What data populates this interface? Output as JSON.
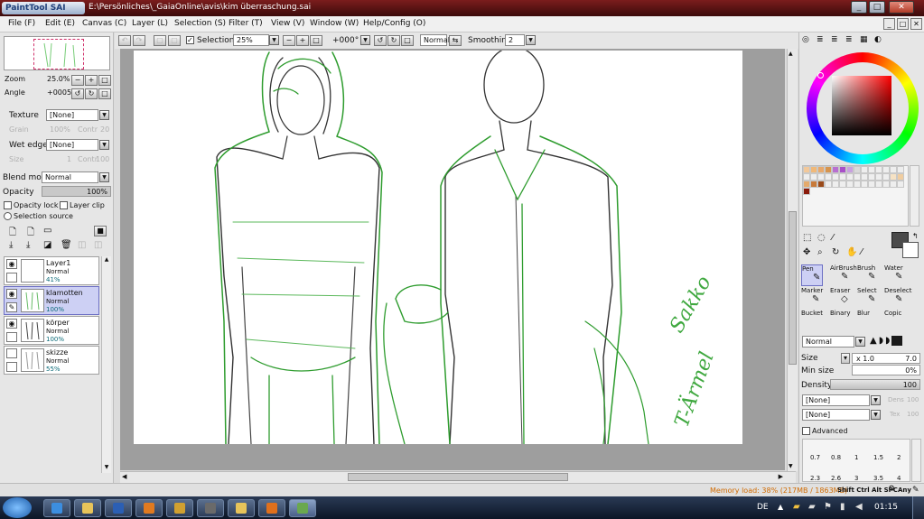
{
  "titlebar": {
    "app": "PaintTool SAI",
    "path": "E:\\Persönliches\\_GaiaOnline\\avis\\kim überraschung.sai",
    "min": "_",
    "max": "□",
    "close": "✕"
  },
  "menu": [
    "File (F)",
    "Edit (E)",
    "Canvas (C)",
    "Layer (L)",
    "Selection (S)",
    "Filter (T)",
    "View (V)",
    "Window (W)",
    "Help/Config (O)"
  ],
  "navigator": {
    "zoom_label": "Zoom",
    "zoom_value": "25.0%",
    "angle_label": "Angle",
    "angle_value": "+0005"
  },
  "texture": {
    "label": "Texture",
    "value": "[None]",
    "grain_label": "Grain",
    "grain_value": "100%",
    "conn_label": "Contr",
    "conn_value": "20"
  },
  "wetedge": {
    "label": "Wet edge",
    "value": "[None]",
    "size_label": "Size",
    "size_value": "1",
    "conn_label": "Contr",
    "conn_value": "100"
  },
  "blend": {
    "label": "Blend mode",
    "value": "Normal"
  },
  "opacity": {
    "label": "Opacity",
    "value": "100%"
  },
  "checks": {
    "opacity_lock": "Opacity lock",
    "layer_clip": "Layer clip",
    "selection_source": "Selection source"
  },
  "layers": [
    {
      "name": "Layer1",
      "mode": "Normal",
      "opacity": "41%",
      "selected": false
    },
    {
      "name": "klamotten",
      "mode": "Normal",
      "opacity": "100%",
      "selected": true
    },
    {
      "name": "körper",
      "mode": "Normal",
      "opacity": "100%",
      "selected": false
    },
    {
      "name": "skizze",
      "mode": "Normal",
      "opacity": "55%",
      "selected": false
    }
  ],
  "canvas_toolbar": {
    "selection_label": "Selection",
    "zoom": "25%",
    "angle": "+000°",
    "mode": "Normal",
    "smoothing_label": "Smoothing",
    "smoothing_value": "2"
  },
  "canvas_text": {
    "word1": "Sakko",
    "word2": "T-Ärmel"
  },
  "tools": [
    {
      "name": "Pen",
      "selected": true
    },
    {
      "name": "AirBrush",
      "selected": false
    },
    {
      "name": "Brush",
      "selected": false
    },
    {
      "name": "Water",
      "selected": false
    },
    {
      "name": "Marker",
      "selected": false
    },
    {
      "name": "Eraser",
      "selected": false
    },
    {
      "name": "Select",
      "selected": false
    },
    {
      "name": "Deselect",
      "selected": false
    },
    {
      "name": "Bucket",
      "selected": false
    },
    {
      "name": "Binary",
      "selected": false
    },
    {
      "name": "Blur",
      "selected": false
    },
    {
      "name": "Copic",
      "selected": false
    }
  ],
  "brush": {
    "mode": "Normal",
    "size_label": "Size",
    "size_mult": "x 1.0",
    "size_value": "7.0",
    "minsize_label": "Min size",
    "minsize_value": "0%",
    "density_label": "Density",
    "density_value": "100",
    "tex1": "[None]",
    "tex1_r": "Dens",
    "tex1_v": "100",
    "tex2": "[None]",
    "tex2_r": "Tex",
    "tex2_v": "100",
    "advanced": "Advanced"
  },
  "brush_sizes": [
    "0.7",
    "0.8",
    "1",
    "1.5",
    "2",
    "2.3",
    "2.6",
    "3",
    "3.5",
    "4"
  ],
  "status": {
    "memory": "Memory load: 38% (217MB / 1863MB)",
    "keys": "Shift Ctrl Alt SPC",
    "any": "Any"
  },
  "taskbar": {
    "lang": "DE",
    "time": "01:15"
  },
  "colors": {
    "accent": "#6c6fc4",
    "title": "#5a1414",
    "memory": "#d06a00"
  }
}
